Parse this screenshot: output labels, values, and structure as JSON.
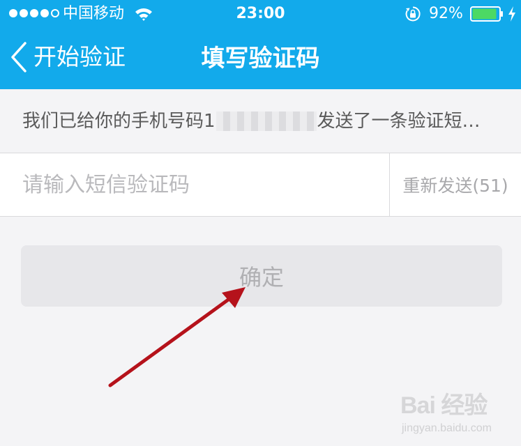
{
  "status_bar": {
    "carrier": "中国移动",
    "time": "23:00",
    "battery_percent": "92%",
    "signal_bars_filled": 4,
    "signal_bars_total": 5,
    "battery_level": 0.92,
    "icons": [
      "wifi-icon",
      "orientation-lock-icon",
      "battery-icon",
      "charging-icon"
    ]
  },
  "nav": {
    "back_label": "开始验证",
    "title": "填写验证码"
  },
  "info": {
    "text_before": "我们已给你的手机号码1",
    "text_after": "发送了一条验证短…"
  },
  "code_input": {
    "placeholder": "请输入短信验证码",
    "value": ""
  },
  "resend": {
    "label": "重新发送(51)"
  },
  "confirm": {
    "label": "确定"
  },
  "annotation": {
    "arrow_color": "#b5121b"
  },
  "watermark": {
    "logo": "Bai 经验",
    "url": "jingyan.baidu.com"
  },
  "colors": {
    "header_bg": "#12aaeb",
    "page_bg": "#f4f4f6",
    "battery_fill": "#4cd964"
  }
}
